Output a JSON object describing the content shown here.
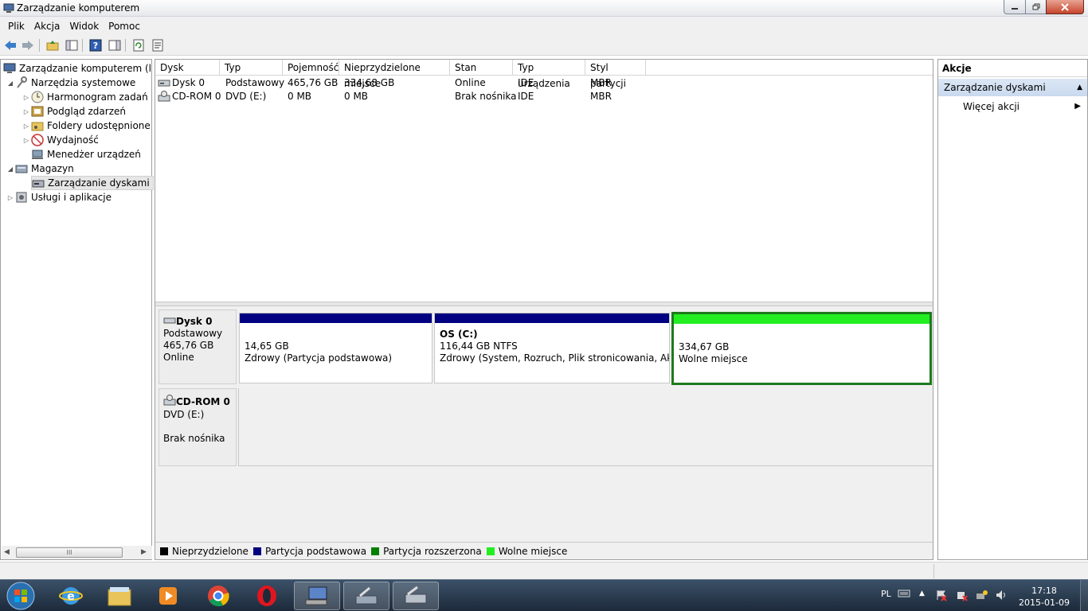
{
  "window": {
    "title": "Zarządzanie komputerem"
  },
  "menu": [
    "Plik",
    "Akcja",
    "Widok",
    "Pomoc"
  ],
  "tree": {
    "root": "Zarządzanie komputerem (lokalne)",
    "system_tools": "Narzędzia systemowe",
    "task_scheduler": "Harmonogram zadań",
    "event_viewer": "Podgląd zdarzeń",
    "shared_folders": "Foldery udostępnione",
    "performance": "Wydajność",
    "device_manager": "Menedżer urządzeń",
    "storage": "Magazyn",
    "disk_management": "Zarządzanie dyskami",
    "services_apps": "Usługi i aplikacje",
    "hscroll_grip": "III"
  },
  "columns": [
    "Dysk",
    "Typ",
    "Pojemność",
    "Nieprzydzielone miejsce",
    "Stan",
    "Typ urządzenia",
    "Styl partycji"
  ],
  "disks": [
    {
      "name": "Dysk 0",
      "type": "Podstawowy",
      "capacity": "465,76 GB",
      "unallocated": "334,68 GB",
      "status": "Online",
      "device": "IDE",
      "style": "MBR"
    },
    {
      "name": "CD-ROM 0",
      "type": "DVD (E:)",
      "capacity": "0 MB",
      "unallocated": "0 MB",
      "status": "Brak nośnika",
      "device": "IDE",
      "style": "MBR"
    }
  ],
  "graph": {
    "disk0": {
      "name": "Dysk 0",
      "type": "Podstawowy",
      "size": "465,76 GB",
      "status": "Online",
      "partitions": [
        {
          "label": "",
          "size": "14,65 GB",
          "status": "Zdrowy (Partycja podstawowa)",
          "color": "#000080"
        },
        {
          "label": "OS  (C:)",
          "size": "116,44 GB NTFS",
          "status": "Zdrowy (System, Rozruch, Plik stronicowania, Aktywny",
          "color": "#000080"
        },
        {
          "label": "",
          "size": "334,67 GB",
          "status": "Wolne miejsce",
          "color": "#22ee22"
        }
      ]
    },
    "cdrom0": {
      "name": "CD-ROM 0",
      "type": "DVD (E:)",
      "status": "Brak nośnika"
    }
  },
  "legend": [
    {
      "label": "Nieprzydzielone",
      "color": "#000000"
    },
    {
      "label": "Partycja podstawowa",
      "color": "#000080"
    },
    {
      "label": "Partycja rozszerzona",
      "color": "#008000"
    },
    {
      "label": "Wolne miejsce",
      "color": "#22ee22"
    }
  ],
  "actions": {
    "title": "Akcje",
    "section": "Zarządzanie dyskami",
    "more": "Więcej akcji"
  },
  "tray": {
    "lang": "PL",
    "time": "17:18",
    "date": "2015-01-09"
  }
}
